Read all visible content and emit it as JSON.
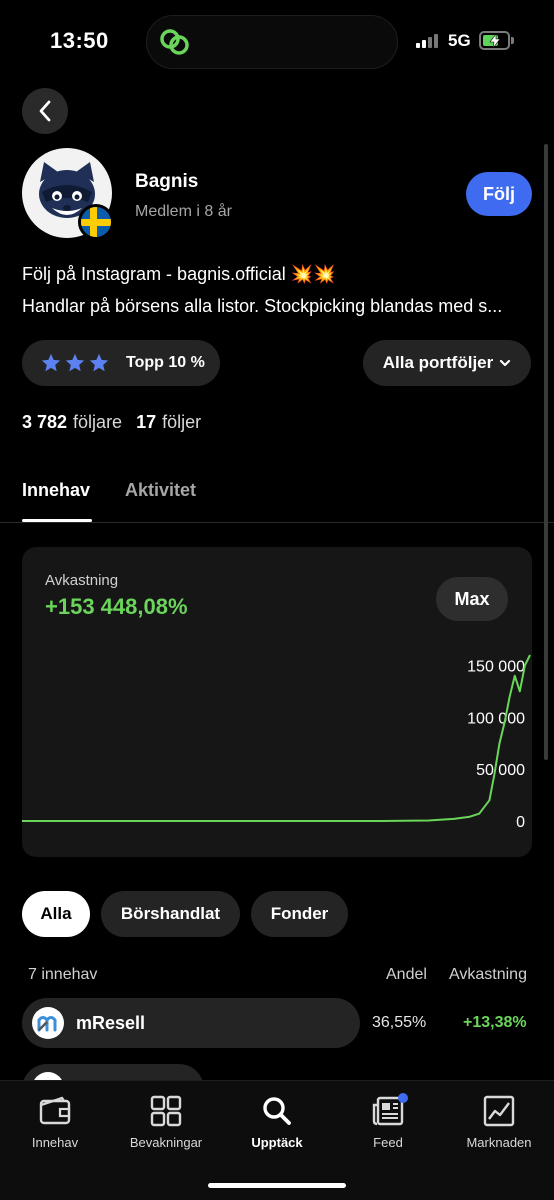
{
  "status_bar": {
    "time": "13:50",
    "network": "5G"
  },
  "profile": {
    "name": "Bagnis",
    "member_since": "Medlem i 8 år",
    "follow_label": "Följ",
    "bio_line1": "Följ på Instagram - bagnis.official 💥💥",
    "bio_line2": "Handlar på börsens alla listor.  Stockpicking blandas med s..."
  },
  "rank": {
    "label": "Topp 10 %",
    "stars": 3,
    "star_color": "#5b82f0"
  },
  "portfolio_selector": {
    "label": "Alla portföljer"
  },
  "stats": {
    "followers": "3 782",
    "followers_label": "följare",
    "following": "17",
    "following_label": "följer"
  },
  "tabs": [
    {
      "label": "Innehav",
      "active": true
    },
    {
      "label": "Aktivitet",
      "active": false
    }
  ],
  "returns": {
    "label": "Avkastning",
    "value": "+153 448,08%",
    "range_label": "Max"
  },
  "chart_data": {
    "type": "line",
    "x": [
      0,
      10,
      20,
      30,
      40,
      50,
      60,
      70,
      80,
      85,
      88,
      90,
      92,
      93,
      94,
      95,
      96,
      97,
      98,
      99,
      100
    ],
    "values": [
      0,
      0,
      0,
      0,
      0,
      0,
      0,
      0,
      500,
      2000,
      4000,
      7000,
      20000,
      45000,
      75000,
      95000,
      120000,
      140000,
      125000,
      150000,
      160000
    ],
    "y_ticks": [
      "150 000",
      "100 000",
      "50 000",
      "0"
    ],
    "ylim": [
      0,
      160000
    ],
    "color": "#6ad55a",
    "grid": false
  },
  "filters": [
    {
      "label": "Alla",
      "active": true
    },
    {
      "label": "Börshandlat",
      "active": false
    },
    {
      "label": "Fonder",
      "active": false
    }
  ],
  "holdings": {
    "count_label": "7 innehav",
    "share_header": "Andel",
    "return_header": "Avkastning",
    "rows": [
      {
        "name": "mResell",
        "share": "36,55%",
        "return": "+13,38%"
      }
    ]
  },
  "bottom_nav": [
    {
      "label": "Innehav",
      "icon": "wallet-icon",
      "active": false
    },
    {
      "label": "Bevakningar",
      "icon": "grid-icon",
      "active": false
    },
    {
      "label": "Upptäck",
      "icon": "search-icon",
      "active": true
    },
    {
      "label": "Feed",
      "icon": "newspaper-icon",
      "active": false
    },
    {
      "label": "Marknaden",
      "icon": "chart-icon",
      "active": false
    }
  ]
}
